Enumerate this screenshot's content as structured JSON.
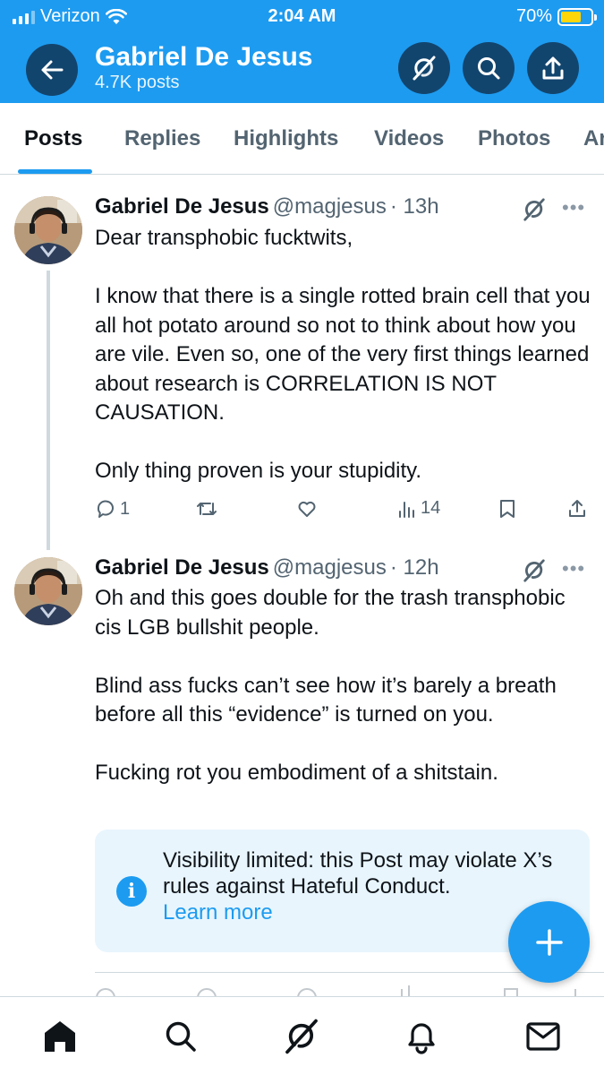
{
  "status_bar": {
    "carrier": "Verizon",
    "time": "2:04 AM",
    "battery": "70%",
    "battery_level": 0.7
  },
  "header": {
    "profile_name": "Gabriel De Jesus",
    "post_count": "4.7K posts",
    "icons": [
      "back-arrow-icon",
      "grok-icon",
      "search-icon",
      "share-icon"
    ]
  },
  "tabs": [
    {
      "label": "Posts",
      "active": true
    },
    {
      "label": "Replies"
    },
    {
      "label": "Highlights"
    },
    {
      "label": "Videos"
    },
    {
      "label": "Photos"
    },
    {
      "label": "Articles"
    }
  ],
  "posts": [
    {
      "name": "Gabriel De Jesus",
      "handle": "@magjesus",
      "time": "· 13h",
      "paragraphs": [
        "Dear transphobic fucktwits,",
        "I know that there is a single rotted brain cell that you all hot potato around so not to think about how you are vile. Even so, one of the very first things learned about research is CORRELATION IS NOT CAUSATION.",
        "Only thing proven is your stupidity."
      ],
      "replies": "1",
      "reposts": "",
      "likes": "",
      "views": "14"
    },
    {
      "name": "Gabriel De Jesus",
      "handle": "@magjesus",
      "time": "· 12h",
      "paragraphs": [
        "Oh and this goes double for the trash transphobic cis LGB bullshit people.",
        "Blind ass fucks can’t see how it’s barely a breath before all this “evidence” is turned on you.",
        "Fucking rot you embodiment of a shitstain."
      ],
      "notice": {
        "text": "Visibility limited: this Post may violate X’s rules against Hateful Conduct.",
        "link": "Learn more"
      }
    }
  ],
  "more_label": "•••",
  "colors": {
    "accent": "#1d9bf0",
    "header_button": "#12456e",
    "text": "#0f1419",
    "secondary_text": "#536471"
  }
}
